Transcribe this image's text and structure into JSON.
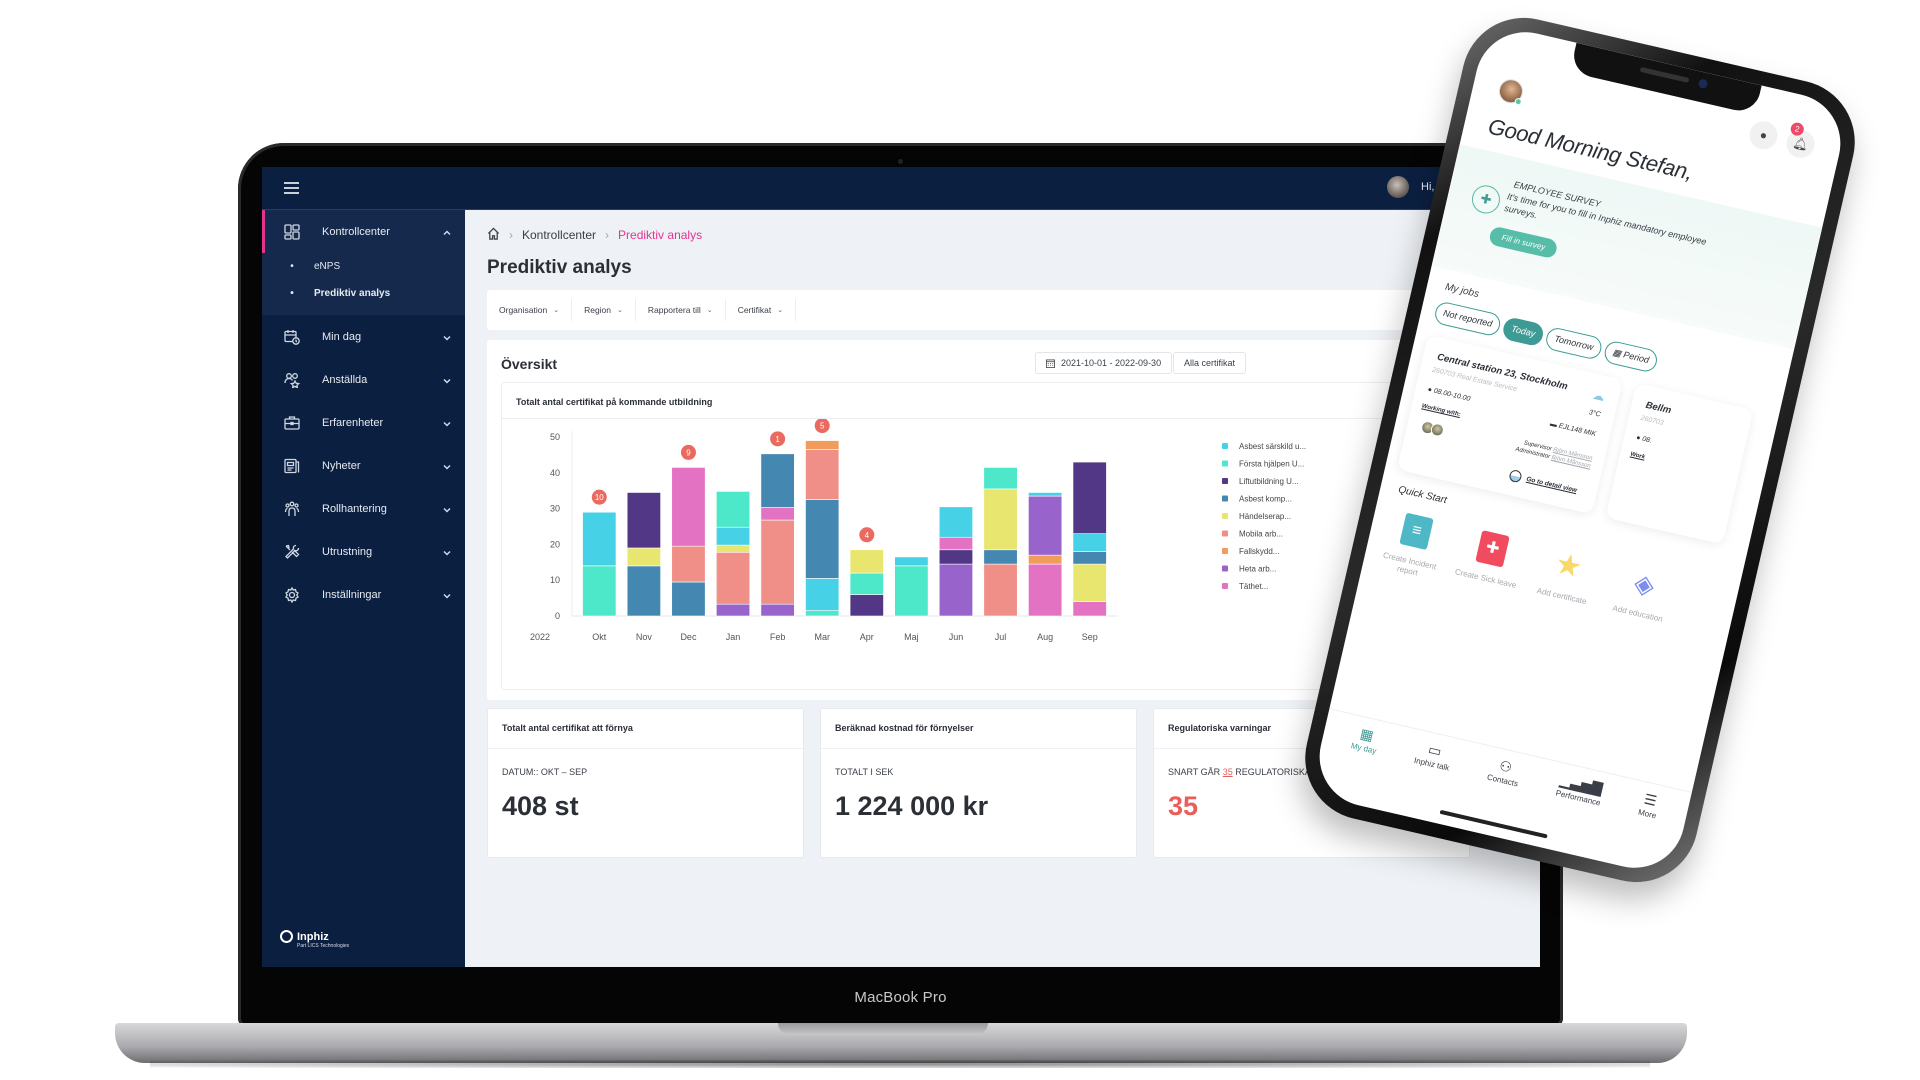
{
  "device": {
    "laptop_label": "MacBook Pro"
  },
  "topbar": {
    "greeting": "Hi, John !"
  },
  "sidebar": {
    "items": [
      {
        "label": "Kontrollcenter",
        "icon": "dashboard-icon",
        "expanded": true,
        "active": true,
        "children": [
          {
            "label": "eNPS"
          },
          {
            "label": "Prediktiv analys",
            "current": true
          }
        ]
      },
      {
        "label": "Min dag",
        "icon": "calendar-clock-icon"
      },
      {
        "label": "Anställda",
        "icon": "employees-icon"
      },
      {
        "label": "Erfarenheter",
        "icon": "briefcase-icon"
      },
      {
        "label": "Nyheter",
        "icon": "news-icon"
      },
      {
        "label": "Rollhantering",
        "icon": "roles-icon"
      },
      {
        "label": "Utrustning",
        "icon": "tools-icon"
      },
      {
        "label": "Inställningar",
        "icon": "gear-icon"
      }
    ],
    "logo": {
      "name": "Inphiz",
      "tagline": "Part LICS Technologies"
    }
  },
  "breadcrumb": {
    "items": [
      "Kontrollcenter",
      "Prediktiv analys"
    ]
  },
  "page": {
    "title": "Prediktiv analys"
  },
  "filters": [
    "Organisation",
    "Region",
    "Rapportera till",
    "Certifikat"
  ],
  "overview": {
    "title": "Översikt",
    "date_range": "2021-10-01 - 2022-09-30",
    "certificate_filter": "Alla certifikat",
    "chart_title": "Totalt antal certifikat på kommande utbildning"
  },
  "chart_data": {
    "type": "bar",
    "stacked": true,
    "title": "Totalt antal certifikat på kommande utbildning",
    "year_label": "2022",
    "categories": [
      "Okt",
      "Nov",
      "Dec",
      "Jan",
      "Feb",
      "Mar",
      "Apr",
      "Maj",
      "Jun",
      "Jul",
      "Aug",
      "Sep"
    ],
    "ylim": [
      0,
      50
    ],
    "yticks": [
      0,
      10,
      20,
      30,
      40,
      50
    ],
    "legend_position": "right",
    "series": [
      {
        "name": "Asbest särskild u...",
        "color": "#47d1e6",
        "values": [
          15,
          0,
          0,
          5,
          0,
          9,
          0,
          2.5,
          8.5,
          0,
          1,
          5
        ]
      },
      {
        "name": "Första hjälpen U...",
        "color": "#4de8c9",
        "values": [
          14,
          0,
          0,
          10,
          0,
          1.5,
          6,
          14,
          0,
          6,
          0,
          0
        ]
      },
      {
        "name": "Liftutbildning U...",
        "color": "#523787",
        "values": [
          0,
          15.5,
          0,
          0,
          0,
          0,
          6,
          0,
          4,
          0,
          0,
          20
        ]
      },
      {
        "name": "Asbest komp...",
        "color": "#4488b1",
        "values": [
          0,
          14,
          9.5,
          0,
          15,
          22,
          0,
          0,
          0,
          4,
          0,
          3.5
        ]
      },
      {
        "name": "Händelserap...",
        "color": "#e8e66f",
        "values": [
          0,
          5,
          0,
          2,
          0,
          0,
          6.5,
          0,
          0,
          17,
          0,
          10.5
        ]
      },
      {
        "name": "Mobila arb...",
        "color": "#ef8f87",
        "values": [
          0,
          0,
          10,
          14.5,
          23.5,
          14,
          0,
          0,
          0,
          14.5,
          0,
          0
        ]
      },
      {
        "name": "Fallskydd...",
        "color": "#f29c5b",
        "values": [
          0,
          0,
          0,
          0,
          0,
          2.5,
          0,
          0,
          0,
          0,
          2.5,
          0
        ]
      },
      {
        "name": "Heta arb...",
        "color": "#9864cc",
        "values": [
          0,
          0,
          0,
          3.3,
          3.3,
          0,
          0,
          0,
          14.5,
          0,
          16.5,
          0
        ]
      },
      {
        "name": "Täthet...",
        "color": "#e372c2",
        "values": [
          0,
          0,
          22,
          0,
          3.5,
          0,
          0,
          0,
          3.5,
          0,
          14.5,
          4
        ]
      }
    ],
    "stack_order": [
      [
        "Första hjälpen U...",
        "Asbest särskild u..."
      ],
      [
        "Asbest komp...",
        "Händelserap...",
        "Liftutbildning U..."
      ],
      [
        "Asbest komp...",
        "Mobila arb...",
        "Täthet..."
      ],
      [
        "Heta arb...",
        "Mobila arb...",
        "Händelserap...",
        "Asbest särskild u...",
        "Första hjälpen U..."
      ],
      [
        "Heta arb...",
        "Mobila arb...",
        "Täthet...",
        "Asbest komp..."
      ],
      [
        "Första hjälpen U...",
        "Asbest särskild u...",
        "Asbest komp...",
        "Mobila arb...",
        "Fallskydd..."
      ],
      [
        "Liftutbildning U...",
        "Första hjälpen U...",
        "Händelserap..."
      ],
      [
        "Första hjälpen U...",
        "Asbest särskild u..."
      ],
      [
        "Heta arb...",
        "Liftutbildning U...",
        "Täthet...",
        "Asbest särskild u..."
      ],
      [
        "Mobila arb...",
        "Asbest komp...",
        "Händelserap...",
        "Första hjälpen U..."
      ],
      [
        "Täthet...",
        "Fallskydd...",
        "Heta arb...",
        "Asbest särskild u..."
      ],
      [
        "Täthet...",
        "Händelserap...",
        "Asbest komp...",
        "Asbest särskild u...",
        "Liftutbildning U..."
      ]
    ],
    "annotations": [
      {
        "category": "Okt",
        "label": "10"
      },
      {
        "category": "Dec",
        "label": "9"
      },
      {
        "category": "Feb",
        "label": "1"
      },
      {
        "category": "Mar",
        "label": "5"
      },
      {
        "category": "Apr",
        "label": "4"
      }
    ],
    "annotation_color": "#ea6a5f"
  },
  "stats": [
    {
      "title": "Totalt antal certifikat att förnya",
      "subtitle": "DATUM:: OKT – SEP",
      "value": "408 st"
    },
    {
      "title": "Beräknad kostnad för förnyelser",
      "subtitle": "TOTALT I SEK",
      "value": "1 224 000 kr"
    },
    {
      "title": "Regulatoriska varningar",
      "subtitle_pre": "SNART GÅR",
      "subtitle_hl": "35",
      "subtitle_post": "REGULATORISKA CERTIFIKAT UT!",
      "value": "35"
    }
  ],
  "phone": {
    "notification_count": "2",
    "greeting": "Good Morning Stefan,",
    "survey": {
      "kicker": "EMPLOYEE SURVEY",
      "text": "It's time for you to fill in Inphiz mandatory employee surveys.",
      "button": "Fill in survey"
    },
    "my_jobs": {
      "title": "My jobs",
      "tabs": [
        {
          "label": "Not reported"
        },
        {
          "label": "Today",
          "active": true
        },
        {
          "label": "Tomorrow"
        },
        {
          "label": "Period"
        }
      ],
      "cards": [
        {
          "title": "Central station 23, Stockholm",
          "subtitle": "260703 Real Estate Service",
          "temperature": "3°C",
          "time": "08.00-10.00",
          "vehicle": "EJL148 MIK",
          "working_with": "Working with:",
          "supervisor_label": "Supervisor",
          "supervisor": "Björn Månsson",
          "administrator_label": "Administrator",
          "administrator": "Björn Månsson",
          "detail_link": "Go to detail view"
        },
        {
          "title": "Bellm",
          "subtitle": "260703",
          "time": "08.",
          "working_with": "Work"
        }
      ]
    },
    "quick_start": {
      "title": "Quick Start",
      "items": [
        {
          "label": "Create Incident report",
          "icon": "document-icon",
          "color": "#4fb8c6"
        },
        {
          "label": "Create Sick leave",
          "icon": "first-aid-kit-icon",
          "color": "#f04b5e"
        },
        {
          "label": "Add certificate",
          "icon": "star-icon",
          "color": "#f7d96a"
        },
        {
          "label": "Add education",
          "icon": "layers-icon",
          "color": "#7c8ef0"
        }
      ]
    },
    "tabbar": [
      {
        "label": "My day",
        "active": true
      },
      {
        "label": "Inphiz talk"
      },
      {
        "label": "Contacts"
      },
      {
        "label": "Performance"
      },
      {
        "label": "More"
      }
    ]
  }
}
